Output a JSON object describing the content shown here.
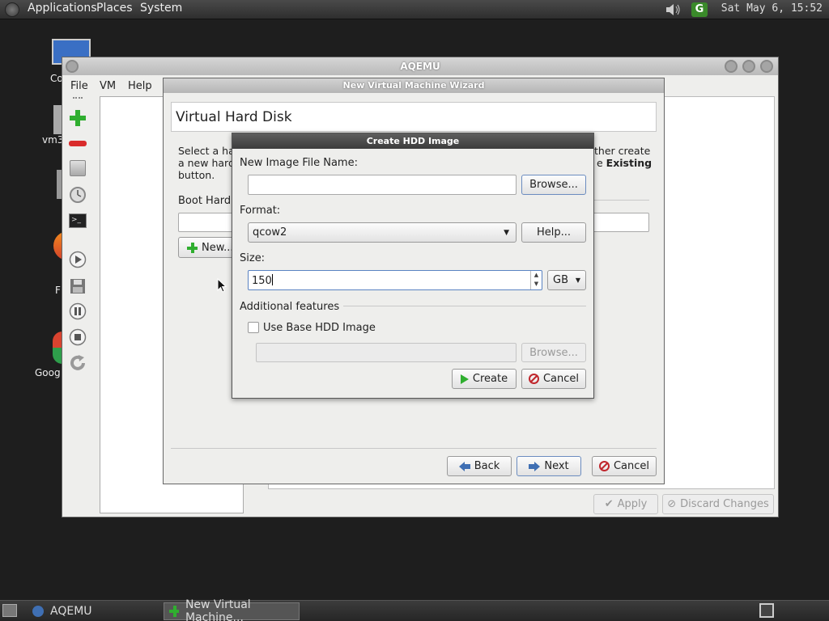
{
  "top_panel": {
    "menus": [
      "Applications",
      "Places",
      "System"
    ],
    "datetime": "Sat May  6, 15:52"
  },
  "desktop": {
    "icons": [
      "Co",
      "vm3",
      "F",
      "Goog"
    ]
  },
  "aqemu": {
    "title": "AQEMU",
    "menu": [
      "File",
      "VM",
      "Help"
    ],
    "apply_label": "Apply",
    "discard_label": "Discard Changes"
  },
  "wizard": {
    "title": "New Virtual Machine Wizard",
    "heading": "Virtual Hard Disk",
    "desc_line1_left": "Select a ha",
    "desc_line1_right": "ther create",
    "desc_line2_left": "a new hard",
    "desc_line2_right_pre": "e ",
    "desc_line2_right_bold": "Existing",
    "desc_line3": "button.",
    "boot_label": "Boot Hard",
    "new_button": "New...",
    "back_button": "Back",
    "next_button": "Next",
    "cancel_button": "Cancel"
  },
  "hdd_dialog": {
    "title": "Create HDD Image",
    "filename_label": "New Image File Name:",
    "filename_value": "",
    "browse_button": "Browse...",
    "format_label": "Format:",
    "format_value": "qcow2",
    "help_button": "Help...",
    "size_label": "Size:",
    "size_value": "150",
    "size_unit": "GB",
    "additional_label": "Additional features",
    "use_base_label": "Use Base HDD Image",
    "use_base_checked": false,
    "base_path_value": "",
    "base_browse_button": "Browse...",
    "create_button": "Create",
    "cancel_button": "Cancel"
  },
  "taskbar": {
    "tasks": [
      "AQEMU",
      "New Virtual Machine..."
    ]
  },
  "colors": {
    "panel": "#3a3a3a",
    "add_green": "#2fae2f",
    "remove_red": "#d92b2b",
    "cancel_red": "#c0262c",
    "arrow_blue": "#3f6fb3"
  }
}
